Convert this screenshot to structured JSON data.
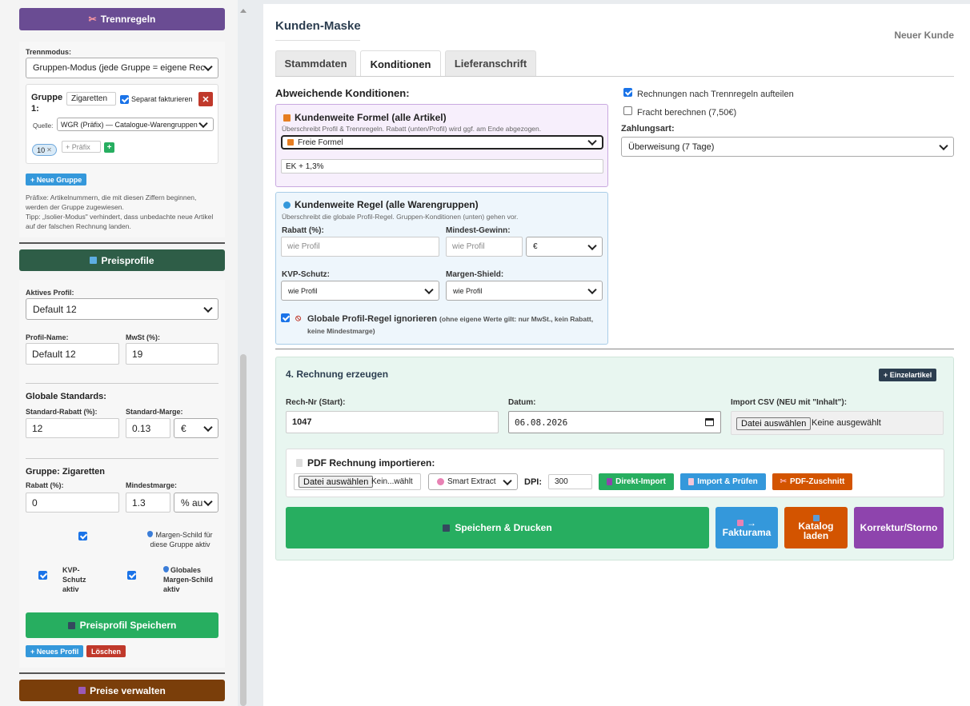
{
  "sidebar": {
    "trennregeln_title": "Trennregeln",
    "trennmodus_label": "Trennmodus:",
    "trennmodus_value": "Gruppen-Modus (jede Gruppe = eigene Rec",
    "group": {
      "label": "Gruppe 1:",
      "name_value": "Zigaretten",
      "separate_label": "Separat fakturieren",
      "close_label": "✕",
      "source_label": "Quelle:",
      "source_value": "WGR (Präfix) — Catalogue-Warengruppen",
      "tag": "10",
      "tag_remove": "✕",
      "prefix_placeholder": "+ Präfix",
      "add_label": "+"
    },
    "new_group_label": "+ Neue Gruppe",
    "hint_1": "Präfixe: Artikelnummern, die mit diesen Ziffern beginnen, werden der Gruppe zugewiesen.",
    "hint_2": "Tipp: „Isolier-Modus\" verhindert, dass unbedachte neue Artikel auf der falschen Rechnung landen.",
    "preisprofile_title": "Preisprofile",
    "active_profile_label": "Aktives Profil:",
    "active_profile_value": "Default 12",
    "profile_name_label": "Profil-Name:",
    "profile_name_value": "Default 12",
    "mwst_label": "MwSt (%):",
    "mwst_value": "19",
    "global_standards_title": "Globale Standards:",
    "std_rabatt_label": "Standard-Rabatt (%):",
    "std_rabatt_value": "12",
    "std_marge_label": "Standard-Marge:",
    "std_marge_value": "0.13",
    "std_marge_unit": "€",
    "group_title": "Gruppe: Zigaretten",
    "group_rabatt_label": "Rabatt (%):",
    "group_rabatt_value": "0",
    "group_min_label": "Mindestmarge:",
    "group_min_value": "1.3",
    "group_min_unit": "% au",
    "margin_shield_group_label": "Margen-Schild für diese Gruppe aktiv",
    "kvp_label": "KVP-Schutz aktiv",
    "global_shield_label": "Globales Margen-Schild aktiv",
    "save_profile_label": "Preisprofil Speichern",
    "new_profile_label": "+ Neues Profil",
    "delete_label": "Löschen",
    "manage_prices_label": "Preise verwalten"
  },
  "main": {
    "title": "Kunden-Maske",
    "new_customer": "Neuer Kunde",
    "tabs": [
      {
        "label": "Stammdaten"
      },
      {
        "label": "Konditionen"
      },
      {
        "label": "Lieferanschrift"
      }
    ],
    "abweichende_title": "Abweichende Konditionen:",
    "formel": {
      "title": "Kundenweite Formel (alle Artikel)",
      "desc": "Überschreibt Profil & Trennregeln. Rabatt (unten/Profil) wird ggf. am Ende abgezogen.",
      "select_value": "Freie Formel",
      "input_value": "EK + 1,3%"
    },
    "regel": {
      "title": "Kundenweite Regel (alle Warengruppen)",
      "desc": "Überschreibt die globale Profil-Regel. Gruppen-Konditionen (unten) gehen vor.",
      "rabatt_label": "Rabatt (%):",
      "rabatt_placeholder": "wie Profil",
      "mindest_label": "Mindest-Gewinn:",
      "mindest_placeholder": "wie Profil",
      "mindest_unit": "€",
      "kvp_label": "KVP-Schutz:",
      "kvp_value": "wie Profil",
      "shield_label": "Margen-Shield:",
      "shield_value": "wie Profil",
      "ignore_label": "Globale Profil-Regel ignorieren",
      "ignore_note": "(ohne eigene Werte gilt: nur MwSt., kein Rabatt, keine Mindestmarge)"
    },
    "right": {
      "split_label": "Rechnungen nach Trennregeln aufteilen",
      "freight_label": "Fracht berechnen (7,50€)",
      "payment_label": "Zahlungsart:",
      "payment_value": "Überweisung (7 Tage)"
    },
    "invoice": {
      "title": "4. Rechnung erzeugen",
      "single_item_label": "+ Einzelartikel",
      "rech_nr_label": "Rech-Nr (Start):",
      "rech_nr_value": "1047",
      "datum_label": "Datum:",
      "datum_value": "06.08.2026",
      "import_label": "Import CSV (NEU mit \"Inhalt\"):",
      "file_button": "Datei auswählen",
      "file_status": "Keine ausgewählt",
      "pdf_title": "PDF Rechnung importieren:",
      "pdf_file_button": "Datei auswählen",
      "pdf_file_status": "Kein...wählt",
      "extract_value": "Smart Extract",
      "dpi_label": "DPI:",
      "dpi_value": "300",
      "direct_import": "Direkt-Import",
      "import_check": "Import & Prüfen",
      "pdf_cut": "PDF-Zuschnitt",
      "save_print": "Speichern & Drucken",
      "fakturama_arrow": "→",
      "fakturama": "Fakturama",
      "katalog_line1": "Katalog",
      "katalog_line2": "laden",
      "korrektur": "Korrektur/Storno"
    }
  },
  "colors": {
    "trennregeln": "#6a4c93",
    "preisprofile": "#2e5d47",
    "preise": "#7a3e0a",
    "green": "#27ae60",
    "blue": "#3498db",
    "orange": "#d35400",
    "purple": "#8e44ad",
    "red": "#c0392b"
  }
}
